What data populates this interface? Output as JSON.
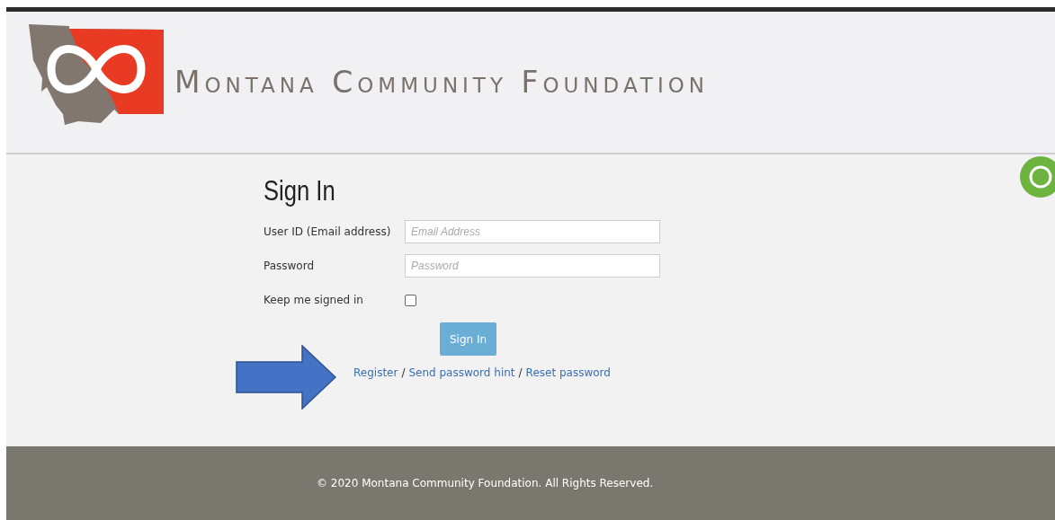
{
  "header": {
    "org_name": "Montana Community Foundation"
  },
  "form": {
    "title": "Sign In",
    "fields": [
      {
        "label": "User ID (Email address)",
        "placeholder": "Email Address"
      },
      {
        "label": "Password",
        "placeholder": "Password"
      }
    ],
    "keep_signed_in": {
      "label": "Keep me signed in",
      "checked": false
    },
    "submit": "Sign In",
    "links": [
      {
        "text": "Register"
      },
      {
        "text": "Send password hint"
      },
      {
        "text": "Reset password"
      }
    ],
    "separator": "/"
  },
  "footer": {
    "text": "© 2020 Montana Community Foundation. All Rights Reserved."
  }
}
